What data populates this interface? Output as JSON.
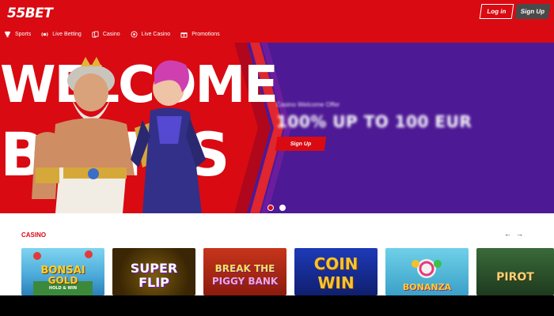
{
  "header": {
    "logo_text": "55BET",
    "login_label": "Log in",
    "signup_label": "Sign Up",
    "brand_color": "#d90a12"
  },
  "nav": {
    "items": [
      {
        "label": "Sports",
        "icon": "trophy-icon"
      },
      {
        "label": "Live Betting",
        "icon": "live-betting-icon"
      },
      {
        "label": "Casino",
        "icon": "cards-icon"
      },
      {
        "label": "Live Casino",
        "icon": "roulette-icon"
      },
      {
        "label": "Promotions",
        "icon": "gift-icon"
      }
    ]
  },
  "hero": {
    "title_line_1": "WELCOME",
    "title_line_2": "BONUS",
    "offer_caption": "Casino Welcome Offer",
    "offer_headline": "100% UP TO 100 EUR",
    "signup_label": "Sign Up",
    "slides_total": 2,
    "active_slide": 1,
    "accent_color": "#4d1995"
  },
  "casino": {
    "section_title": "CASINO",
    "prev_arrow": "←",
    "next_arrow": "→",
    "games": [
      {
        "title": "BONSAI\nGOLD",
        "subtitle": "HOLD & WIN"
      },
      {
        "title": "SUPER\nFLIP"
      },
      {
        "title": "BREAK THE\nPIGGY BANK"
      },
      {
        "title": "COIN\nWIN"
      },
      {
        "title": "BONANZA"
      },
      {
        "title": "PIROT"
      }
    ]
  }
}
